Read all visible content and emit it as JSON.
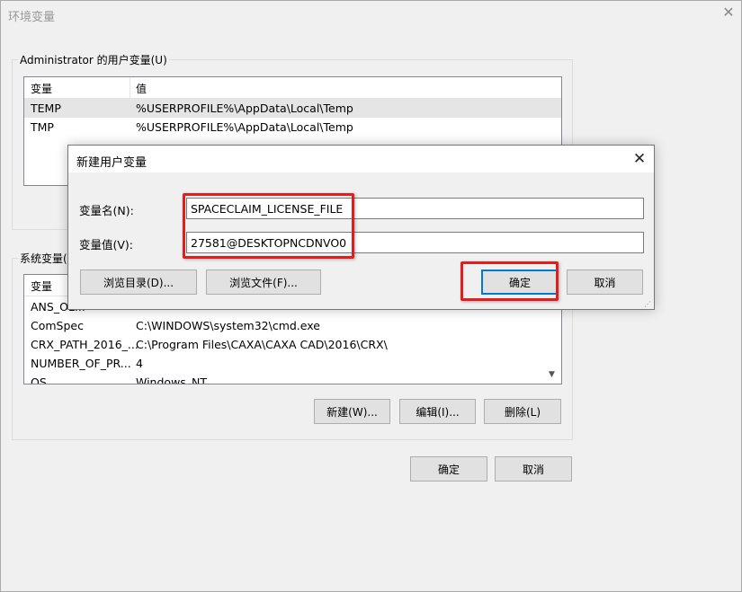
{
  "outer": {
    "title": "环境变量",
    "user_group_label": "Administrator 的用户变量(U)",
    "user_vars": {
      "headers": [
        "变量",
        "值"
      ],
      "rows": [
        {
          "name": "TEMP",
          "value": "%USERPROFILE%\\AppData\\Local\\Temp"
        },
        {
          "name": "TMP",
          "value": "%USERPROFILE%\\AppData\\Local\\Temp"
        }
      ]
    },
    "system_group_label": "系统变量(",
    "system_vars": {
      "header": "变量",
      "rows": [
        {
          "name": "ANS_OL...",
          "value": ""
        },
        {
          "name": "ComSpec",
          "value": "C:\\WINDOWS\\system32\\cmd.exe"
        },
        {
          "name": "CRX_PATH_2016_...",
          "value": "C:\\Program Files\\CAXA\\CAXA CAD\\2016\\CRX\\"
        },
        {
          "name": "NUMBER_OF_PR...",
          "value": "4"
        },
        {
          "name": "OS",
          "value": "Windows_NT"
        }
      ]
    },
    "system_buttons": {
      "new": "新建(W)...",
      "edit": "编辑(I)...",
      "delete": "删除(L)"
    },
    "ok": "确定",
    "cancel": "取消"
  },
  "dialog": {
    "title": "新建用户变量",
    "name_label": "变量名(N):",
    "name_value": "SPACECLAIM_LICENSE_FILE",
    "value_label": "变量值(V):",
    "value_value": "27581@DESKTOPNCDNVO0",
    "browse_dir": "浏览目录(D)...",
    "browse_file": "浏览文件(F)...",
    "ok": "确定",
    "cancel": "取消"
  },
  "colors": {
    "highlight": "#e21d1d",
    "focus": "#0078d7"
  },
  "icons": {
    "close": "close-icon",
    "scroll_down": "chevron-down-icon",
    "grip": "resize-grip-icon"
  }
}
